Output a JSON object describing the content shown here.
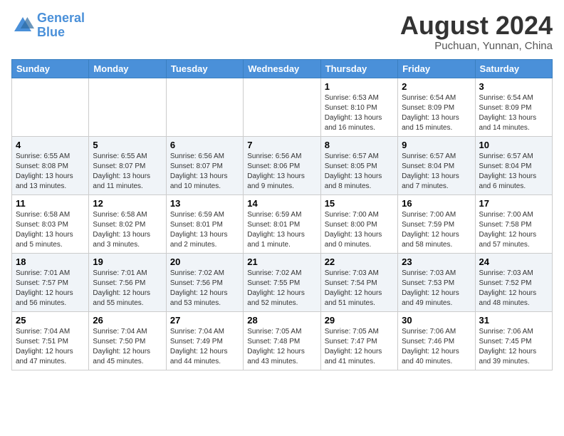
{
  "header": {
    "logo_general": "General",
    "logo_blue": "Blue",
    "month_title": "August 2024",
    "location": "Puchuan, Yunnan, China"
  },
  "weekdays": [
    "Sunday",
    "Monday",
    "Tuesday",
    "Wednesday",
    "Thursday",
    "Friday",
    "Saturday"
  ],
  "weeks": [
    [
      {
        "day": "",
        "info": ""
      },
      {
        "day": "",
        "info": ""
      },
      {
        "day": "",
        "info": ""
      },
      {
        "day": "",
        "info": ""
      },
      {
        "day": "1",
        "info": "Sunrise: 6:53 AM\nSunset: 8:10 PM\nDaylight: 13 hours\nand 16 minutes."
      },
      {
        "day": "2",
        "info": "Sunrise: 6:54 AM\nSunset: 8:09 PM\nDaylight: 13 hours\nand 15 minutes."
      },
      {
        "day": "3",
        "info": "Sunrise: 6:54 AM\nSunset: 8:09 PM\nDaylight: 13 hours\nand 14 minutes."
      }
    ],
    [
      {
        "day": "4",
        "info": "Sunrise: 6:55 AM\nSunset: 8:08 PM\nDaylight: 13 hours\nand 13 minutes."
      },
      {
        "day": "5",
        "info": "Sunrise: 6:55 AM\nSunset: 8:07 PM\nDaylight: 13 hours\nand 11 minutes."
      },
      {
        "day": "6",
        "info": "Sunrise: 6:56 AM\nSunset: 8:07 PM\nDaylight: 13 hours\nand 10 minutes."
      },
      {
        "day": "7",
        "info": "Sunrise: 6:56 AM\nSunset: 8:06 PM\nDaylight: 13 hours\nand 9 minutes."
      },
      {
        "day": "8",
        "info": "Sunrise: 6:57 AM\nSunset: 8:05 PM\nDaylight: 13 hours\nand 8 minutes."
      },
      {
        "day": "9",
        "info": "Sunrise: 6:57 AM\nSunset: 8:04 PM\nDaylight: 13 hours\nand 7 minutes."
      },
      {
        "day": "10",
        "info": "Sunrise: 6:57 AM\nSunset: 8:04 PM\nDaylight: 13 hours\nand 6 minutes."
      }
    ],
    [
      {
        "day": "11",
        "info": "Sunrise: 6:58 AM\nSunset: 8:03 PM\nDaylight: 13 hours\nand 5 minutes."
      },
      {
        "day": "12",
        "info": "Sunrise: 6:58 AM\nSunset: 8:02 PM\nDaylight: 13 hours\nand 3 minutes."
      },
      {
        "day": "13",
        "info": "Sunrise: 6:59 AM\nSunset: 8:01 PM\nDaylight: 13 hours\nand 2 minutes."
      },
      {
        "day": "14",
        "info": "Sunrise: 6:59 AM\nSunset: 8:01 PM\nDaylight: 13 hours\nand 1 minute."
      },
      {
        "day": "15",
        "info": "Sunrise: 7:00 AM\nSunset: 8:00 PM\nDaylight: 13 hours\nand 0 minutes."
      },
      {
        "day": "16",
        "info": "Sunrise: 7:00 AM\nSunset: 7:59 PM\nDaylight: 12 hours\nand 58 minutes."
      },
      {
        "day": "17",
        "info": "Sunrise: 7:00 AM\nSunset: 7:58 PM\nDaylight: 12 hours\nand 57 minutes."
      }
    ],
    [
      {
        "day": "18",
        "info": "Sunrise: 7:01 AM\nSunset: 7:57 PM\nDaylight: 12 hours\nand 56 minutes."
      },
      {
        "day": "19",
        "info": "Sunrise: 7:01 AM\nSunset: 7:56 PM\nDaylight: 12 hours\nand 55 minutes."
      },
      {
        "day": "20",
        "info": "Sunrise: 7:02 AM\nSunset: 7:56 PM\nDaylight: 12 hours\nand 53 minutes."
      },
      {
        "day": "21",
        "info": "Sunrise: 7:02 AM\nSunset: 7:55 PM\nDaylight: 12 hours\nand 52 minutes."
      },
      {
        "day": "22",
        "info": "Sunrise: 7:03 AM\nSunset: 7:54 PM\nDaylight: 12 hours\nand 51 minutes."
      },
      {
        "day": "23",
        "info": "Sunrise: 7:03 AM\nSunset: 7:53 PM\nDaylight: 12 hours\nand 49 minutes."
      },
      {
        "day": "24",
        "info": "Sunrise: 7:03 AM\nSunset: 7:52 PM\nDaylight: 12 hours\nand 48 minutes."
      }
    ],
    [
      {
        "day": "25",
        "info": "Sunrise: 7:04 AM\nSunset: 7:51 PM\nDaylight: 12 hours\nand 47 minutes."
      },
      {
        "day": "26",
        "info": "Sunrise: 7:04 AM\nSunset: 7:50 PM\nDaylight: 12 hours\nand 45 minutes."
      },
      {
        "day": "27",
        "info": "Sunrise: 7:04 AM\nSunset: 7:49 PM\nDaylight: 12 hours\nand 44 minutes."
      },
      {
        "day": "28",
        "info": "Sunrise: 7:05 AM\nSunset: 7:48 PM\nDaylight: 12 hours\nand 43 minutes."
      },
      {
        "day": "29",
        "info": "Sunrise: 7:05 AM\nSunset: 7:47 PM\nDaylight: 12 hours\nand 41 minutes."
      },
      {
        "day": "30",
        "info": "Sunrise: 7:06 AM\nSunset: 7:46 PM\nDaylight: 12 hours\nand 40 minutes."
      },
      {
        "day": "31",
        "info": "Sunrise: 7:06 AM\nSunset: 7:45 PM\nDaylight: 12 hours\nand 39 minutes."
      }
    ]
  ]
}
